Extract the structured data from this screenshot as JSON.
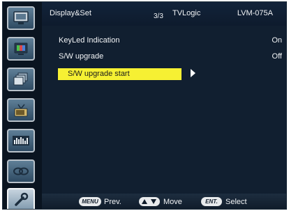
{
  "header": {
    "section": "Display&Set",
    "page": "3/3",
    "brand": "TVLogic",
    "model": "LVM-075A"
  },
  "menu": {
    "items": [
      {
        "label": "KeyLed Indication",
        "value": "On"
      },
      {
        "label": "S/W upgrade",
        "value": "Off"
      }
    ],
    "selected": {
      "label": "S/W upgrade start"
    }
  },
  "sidebar": {
    "items": [
      {
        "icon": "monitor-icon"
      },
      {
        "icon": "color-display-icon"
      },
      {
        "icon": "layers-icon"
      },
      {
        "icon": "antenna-tv-icon"
      },
      {
        "icon": "audio-meter-icon"
      },
      {
        "icon": "link-icon"
      },
      {
        "icon": "wrench-icon",
        "active": true
      }
    ]
  },
  "footer": {
    "menu_key": "MENU",
    "prev_label": "Prev.",
    "move_label": "Move",
    "ent_key": "ENT.",
    "select_label": "Select"
  }
}
